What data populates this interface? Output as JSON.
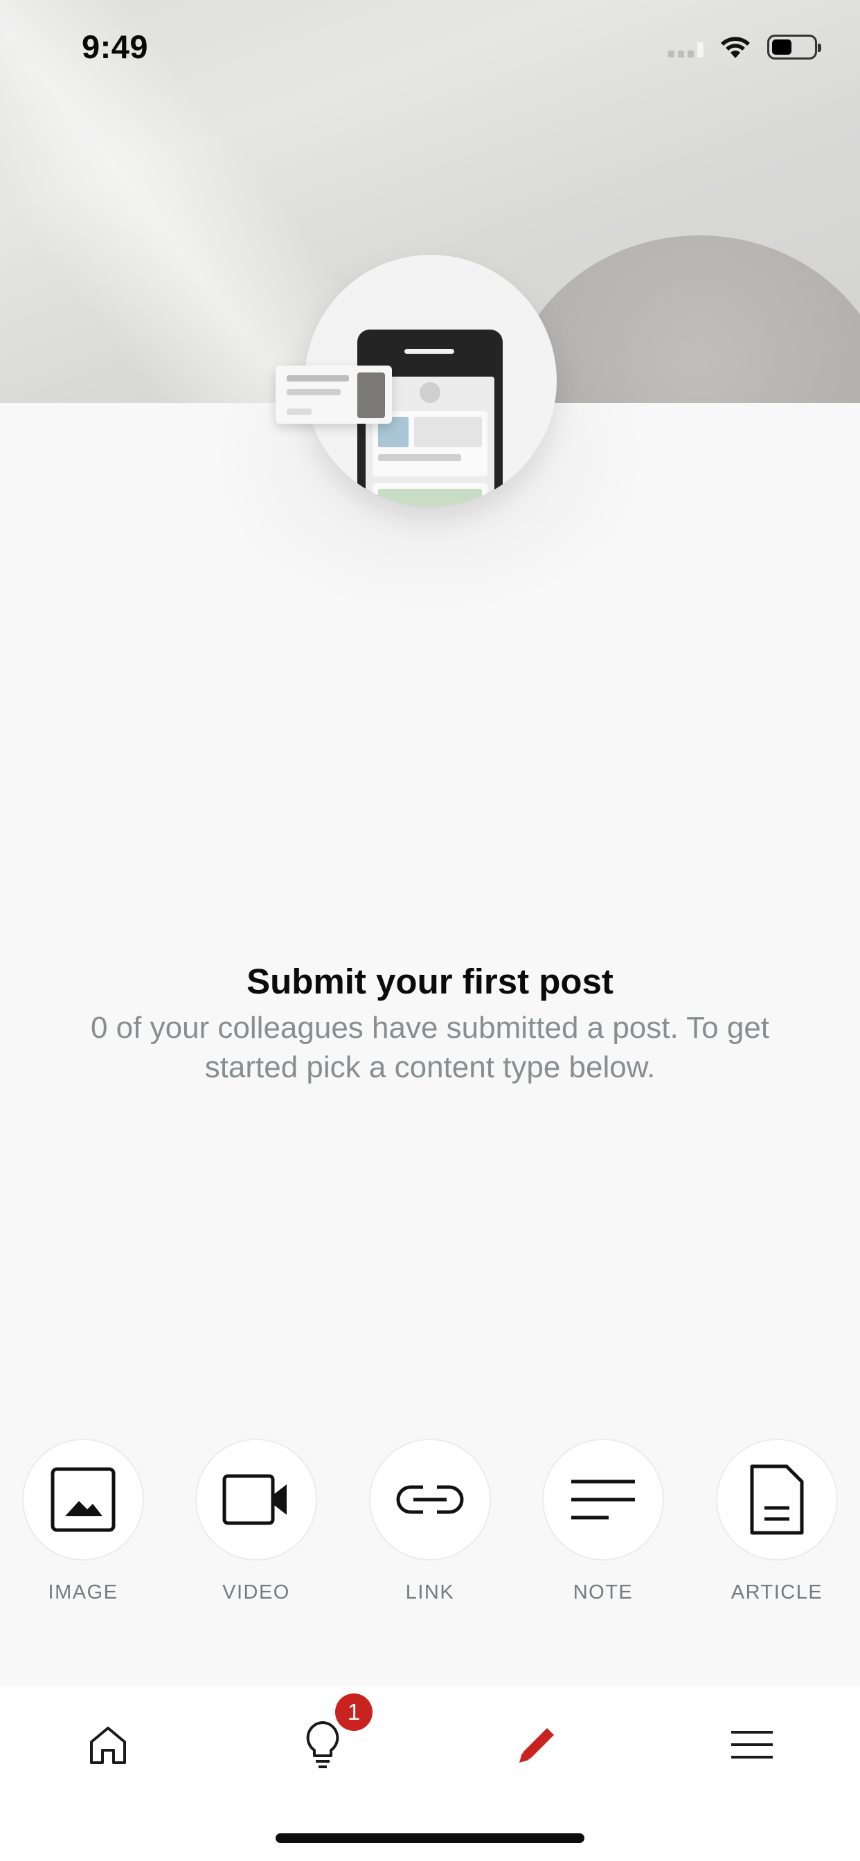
{
  "status_bar": {
    "time": "9:49"
  },
  "empty_state": {
    "title": "Submit your first post",
    "subtitle": "0 of your colleagues have submitted a post. To get started pick a content type below."
  },
  "content_types": [
    {
      "label": "IMAGE",
      "icon": "image-icon"
    },
    {
      "label": "VIDEO",
      "icon": "video-icon"
    },
    {
      "label": "LINK",
      "icon": "link-icon"
    },
    {
      "label": "NOTE",
      "icon": "note-icon"
    },
    {
      "label": "ARTICLE",
      "icon": "article-icon"
    }
  ],
  "tab_bar": {
    "items": [
      {
        "icon": "home-icon",
        "active": false
      },
      {
        "icon": "lightbulb-icon",
        "active": false,
        "badge": "1"
      },
      {
        "icon": "pencil-icon",
        "active": true
      },
      {
        "icon": "menu-icon",
        "active": false
      }
    ],
    "active_color": "#c8231e",
    "icon_color": "#1a1a1a"
  },
  "colors": {
    "accent": "#c8231e",
    "background": "#f7f8f7",
    "subtitle_text": "#8a8d8f"
  }
}
